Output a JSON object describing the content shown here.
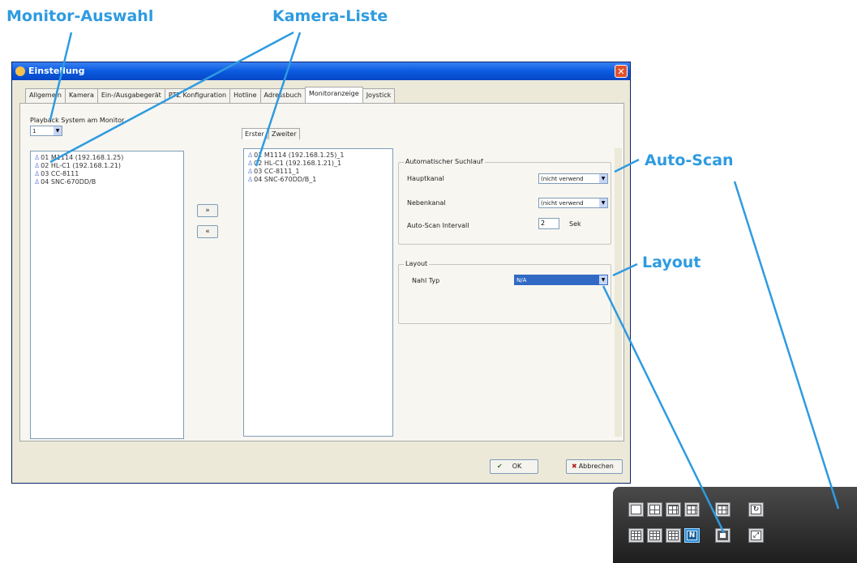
{
  "callouts": {
    "monitor": "Monitor-Auswahl",
    "camera_list": "Kamera-Liste",
    "auto_scan": "Auto-Scan",
    "layout": "Layout"
  },
  "window": {
    "title": "Einstellung",
    "tabs": [
      "Allgemein",
      "Kamera",
      "Ein-/Ausgabegerät",
      "PTZ Konfiguration",
      "Hotline",
      "Adressbuch",
      "Monitoranzeige",
      "Joystick"
    ],
    "active_tab": "Monitoranzeige"
  },
  "panel": {
    "monitor_label": "Playback System am Monitor",
    "monitor_value": "1",
    "left_cameras": [
      "01 M1114 (192.168.1.25)",
      "02 HL-C1 (192.168.1.21)",
      "03 CC-8111",
      "04 SNC-670DD/B"
    ],
    "move_right": "»",
    "move_left": "«",
    "subtabs": [
      "Erster",
      "Zweiter"
    ],
    "right_cameras": [
      "01 M1114 (192.168.1.25)_1",
      "02 HL-C1 (192.168.1.21)_1",
      "03 CC-8111_1",
      "04 SNC-670DD/B_1"
    ]
  },
  "autoscan": {
    "group_title": "Automatischer Suchlauf",
    "main_channel_label": "Hauptkanal",
    "main_channel_value": "(nicht verwend",
    "sub_channel_label": "Nebenkanal",
    "sub_channel_value": "(nicht verwend",
    "interval_label": "Auto-Scan Intervall",
    "interval_value": "2",
    "interval_unit": "Sek"
  },
  "layout_group": {
    "title": "Layout",
    "type_label": "Nahl Typ",
    "type_value": "N/A"
  },
  "buttons": {
    "ok": "OK",
    "cancel": "Abbrechen"
  },
  "toolbar": {
    "selected_label": "N"
  },
  "colors": {
    "callout": "#2e9be0",
    "titlebar": "#0a5ae0",
    "selected_dropdown": "#316ac5"
  }
}
